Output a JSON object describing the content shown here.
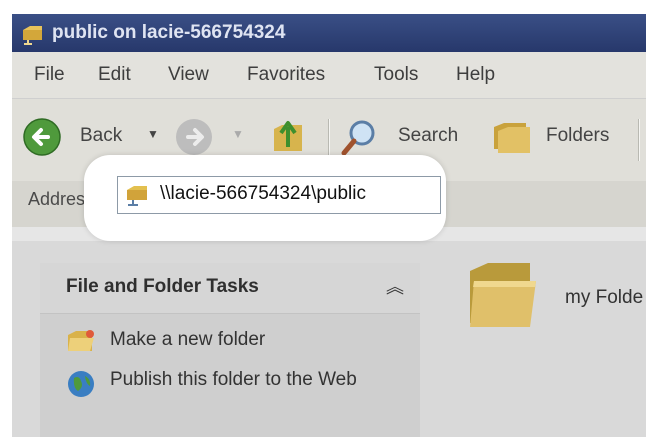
{
  "window": {
    "title": "public on lacie-566754324"
  },
  "menu": {
    "items": [
      "File",
      "Edit",
      "View",
      "Favorites",
      "Tools",
      "Help"
    ]
  },
  "toolbar": {
    "back_label": "Back",
    "search_label": "Search",
    "folders_label": "Folders"
  },
  "address": {
    "label": "Address",
    "value": "\\\\lacie-566754324\\public"
  },
  "tasks": {
    "title": "File and Folder Tasks",
    "items": [
      {
        "label": "Make a new folder",
        "icon": "new-folder-icon"
      },
      {
        "label": "Publish this folder to the Web",
        "icon": "globe-icon"
      }
    ]
  },
  "content": {
    "folder_label": "my Folde"
  },
  "colors": {
    "titlebar": "#27386b",
    "background": "#d9d9d9",
    "highlight": "#ffffff"
  }
}
